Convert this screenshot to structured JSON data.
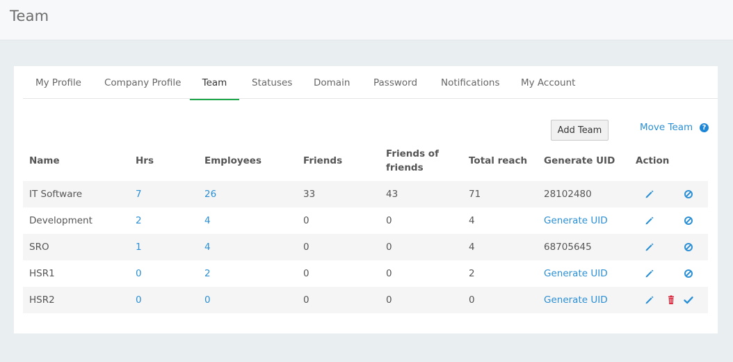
{
  "header": {
    "title": "Team"
  },
  "tabs": [
    {
      "label": "My Profile",
      "active": false
    },
    {
      "label": "Company Profile",
      "active": false
    },
    {
      "label": "Team",
      "active": true
    },
    {
      "label": "Statuses",
      "active": false
    },
    {
      "label": "Domain",
      "active": false
    },
    {
      "label": "Password",
      "active": false
    },
    {
      "label": "Notifications",
      "active": false
    },
    {
      "label": "My Account",
      "active": false
    }
  ],
  "toolbar": {
    "add_team_label": "Add Team",
    "move_team_label": "Move Team",
    "help_icon": "help-icon"
  },
  "table": {
    "columns": {
      "name": "Name",
      "hrs": "Hrs",
      "employees": "Employees",
      "friends": "Friends",
      "friends_of_friends_line1": "Friends of",
      "friends_of_friends_line2": "friends",
      "total_reach": "Total reach",
      "generate_uid": "Generate UID",
      "action": "Action"
    },
    "rows": [
      {
        "name": "IT Software",
        "hrs": "7",
        "employees": "26",
        "friends": "33",
        "fof": "43",
        "reach": "71",
        "uid": "28102480",
        "uid_is_link": false,
        "actions": [
          "edit-icon",
          "block-icon"
        ]
      },
      {
        "name": "Development",
        "hrs": "2",
        "employees": "4",
        "friends": "0",
        "fof": "0",
        "reach": "4",
        "uid": "Generate UID",
        "uid_is_link": true,
        "actions": [
          "edit-icon",
          "block-icon"
        ]
      },
      {
        "name": "SRO",
        "hrs": "1",
        "employees": "4",
        "friends": "0",
        "fof": "0",
        "reach": "4",
        "uid": "68705645",
        "uid_is_link": false,
        "actions": [
          "edit-icon",
          "block-icon"
        ]
      },
      {
        "name": "HSR1",
        "hrs": "0",
        "employees": "2",
        "friends": "0",
        "fof": "0",
        "reach": "2",
        "uid": "Generate UID",
        "uid_is_link": true,
        "actions": [
          "edit-icon",
          "block-icon"
        ]
      },
      {
        "name": "HSR2",
        "hrs": "0",
        "employees": "0",
        "friends": "0",
        "fof": "0",
        "reach": "0",
        "uid": "Generate UID",
        "uid_is_link": true,
        "actions": [
          "edit-icon",
          "delete-icon",
          "check-icon"
        ]
      }
    ]
  },
  "colors": {
    "accent": "#2a8fd4",
    "active_tab": "#1ea64a",
    "delete": "#d9263b"
  }
}
